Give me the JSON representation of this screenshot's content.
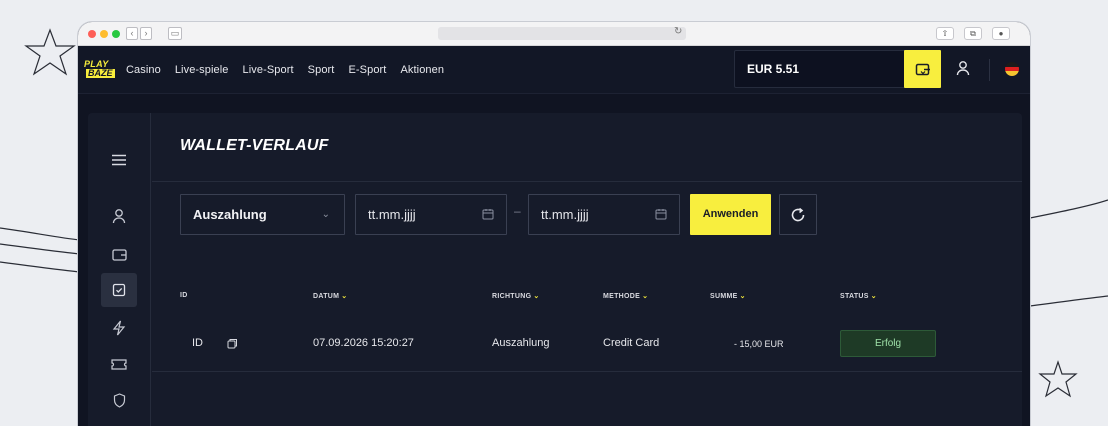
{
  "brand": {
    "logo_line1": "PLAY",
    "logo_line2": "BAZE",
    "accent": "#f8ee3e",
    "background": "#161b2a",
    "success": "#1e3a26"
  },
  "topnav": {
    "links": [
      "Casino",
      "Live-spiele",
      "Live-Sport",
      "Sport",
      "E-Sport",
      "Aktionen"
    ],
    "balance": "EUR 5.51",
    "wallet_icon": "wallet-icon",
    "user_icon": "user-icon",
    "language_flag": "de-flag-icon"
  },
  "sidebar": {
    "items": [
      {
        "icon": "menu-icon",
        "active": false
      },
      {
        "icon": "user-icon",
        "active": false
      },
      {
        "icon": "wallet-icon",
        "active": false
      },
      {
        "icon": "history-icon",
        "active": true
      },
      {
        "icon": "bolt-icon",
        "active": false
      },
      {
        "icon": "ticket-icon",
        "active": false
      },
      {
        "icon": "shield-icon",
        "active": false
      }
    ]
  },
  "page": {
    "title": "WALLET-VERLAUF"
  },
  "filters": {
    "type_selected": "Auszahlung",
    "date_from_placeholder": "tt.mm.jjjj",
    "date_separator": "–",
    "date_to_placeholder": "tt.mm.jjjj",
    "apply_label": "Anwenden",
    "refresh_icon": "refresh-icon"
  },
  "table": {
    "headers": [
      "ID",
      "DATUM",
      "RICHTUNG",
      "METHODE",
      "SUMME",
      "STATUS"
    ],
    "rows": [
      {
        "id": "ID",
        "date": "07.09.2026 15:20:27",
        "direction": "Auszahlung",
        "method": "Credit Card",
        "amount": "- 15,00 EUR",
        "status": "Erfolg"
      }
    ]
  }
}
